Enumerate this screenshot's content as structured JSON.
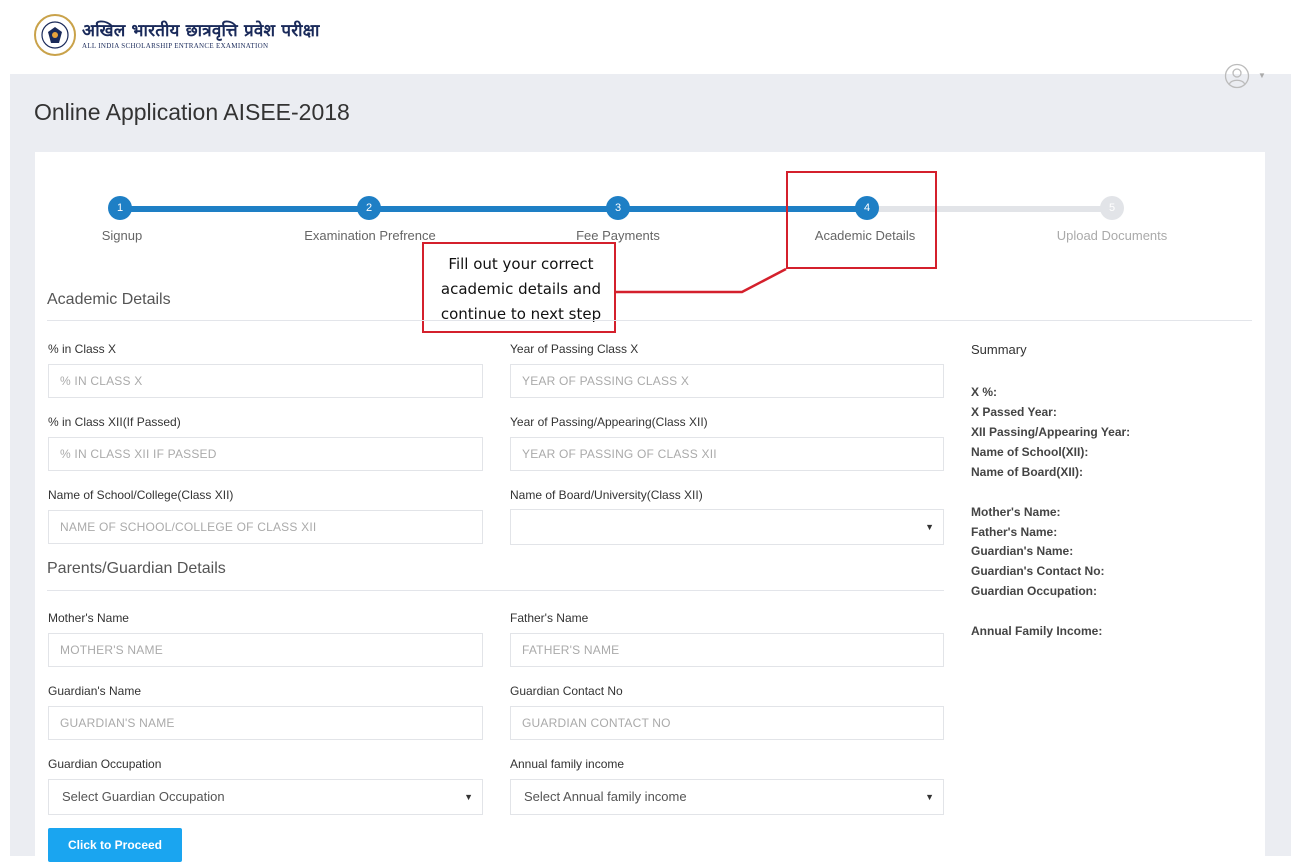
{
  "header": {
    "logo_hindi": "अखिल भारतीय छात्रवृत्ति प्रवेश परीक्षा",
    "logo_english": "ALL INDIA SCHOLARSHIP ENTRANCE EXAMINATION",
    "user_icon": "user-circle-icon"
  },
  "page_title": "Online Application AISEE-2018",
  "stepper": {
    "steps": [
      {
        "number": "1",
        "label": "Signup",
        "state": "done"
      },
      {
        "number": "2",
        "label": "Examination Prefrence",
        "state": "done"
      },
      {
        "number": "3",
        "label": "Fee Payments",
        "state": "done"
      },
      {
        "number": "4",
        "label": "Academic Details",
        "state": "current"
      },
      {
        "number": "5",
        "label": "Upload Documents",
        "state": "todo"
      }
    ]
  },
  "callout": {
    "line1": "Fill out your correct",
    "line2": "academic details and",
    "line3": "continue to next step"
  },
  "academic": {
    "title": "Academic Details",
    "class_x_label": "% in Class X",
    "class_x_placeholder": "% IN CLASS X",
    "year_x_label": "Year of Passing Class X",
    "year_x_placeholder": "YEAR OF PASSING CLASS X",
    "class_xii_label": "% in Class XII(If Passed)",
    "class_xii_placeholder": "% IN CLASS XII IF PASSED",
    "year_xii_label": "Year of Passing/Appearing(Class XII)",
    "year_xii_placeholder": "YEAR OF PASSING OF CLASS XII",
    "school_label": "Name of School/College(Class XII)",
    "school_placeholder": "NAME OF SCHOOL/COLLEGE OF CLASS XII",
    "board_label": "Name of Board/University(Class XII)",
    "board_value": ""
  },
  "parents": {
    "title": "Parents/Guardian Details",
    "mother_label": "Mother's Name",
    "mother_placeholder": "MOTHER'S NAME",
    "father_label": "Father's Name",
    "father_placeholder": "FATHER'S NAME",
    "guardian_label": "Guardian's Name",
    "guardian_placeholder": "GUARDIAN'S NAME",
    "guardian_contact_label": "Guardian Contact No",
    "guardian_contact_placeholder": "GUARDIAN CONTACT NO",
    "occupation_label": "Guardian Occupation",
    "occupation_value": "Select Guardian Occupation",
    "income_label": "Annual family income",
    "income_value": "Select Annual family income"
  },
  "summary": {
    "title": "Summary",
    "x_percent": "X %:",
    "x_passed_year": "X Passed Year:",
    "xii_year": "XII Passing/Appearing Year:",
    "school": "Name of School(XII):",
    "board": "Name of Board(XII):",
    "mother": "Mother's Name:",
    "father": "Father's Name:",
    "guardian": "Guardian's Name:",
    "guardian_contact": "Guardian's Contact No:",
    "guardian_occupation": "Guardian Occupation:",
    "income": "Annual Family Income:"
  },
  "proceed_label": "Click to Proceed",
  "colors": {
    "accent": "#1e7fc5",
    "button": "#1aa5f0",
    "highlight": "#d4202c"
  }
}
